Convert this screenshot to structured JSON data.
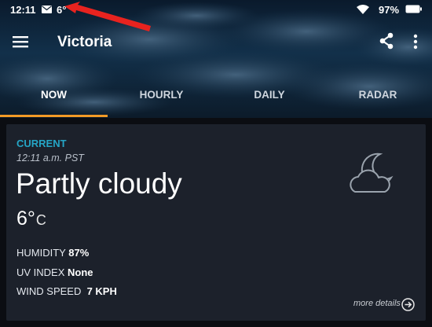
{
  "status_bar": {
    "time": "12:11",
    "temperature": "6°",
    "battery": "97%",
    "icons": [
      "mail-icon",
      "wifi-icon",
      "battery-icon"
    ]
  },
  "app_bar": {
    "city": "Victoria",
    "icons": [
      "menu-icon",
      "share-icon",
      "more-vert-icon"
    ]
  },
  "tabs": [
    {
      "label": "NOW",
      "active": true
    },
    {
      "label": "HOURLY",
      "active": false
    },
    {
      "label": "DAILY",
      "active": false
    },
    {
      "label": "RADAR",
      "active": false
    }
  ],
  "current": {
    "section_label": "CURRENT",
    "time": "12:11 a.m. PST",
    "condition": "Partly cloudy",
    "condition_icon": "moon-cloud-icon",
    "temperature": "6",
    "temperature_degree": "°",
    "temperature_unit": "C",
    "stats": [
      {
        "label": "HUMIDITY",
        "value": "87%"
      },
      {
        "label": "UV INDEX",
        "value": "None"
      },
      {
        "label": "WIND SPEED",
        "value": "7 KPH"
      }
    ],
    "more_details_label": "more details"
  },
  "colors": {
    "accent": "#f39a26",
    "section_label": "#25a5c5",
    "card_background": "#1c212b",
    "annotation_arrow": "#e8231f"
  }
}
